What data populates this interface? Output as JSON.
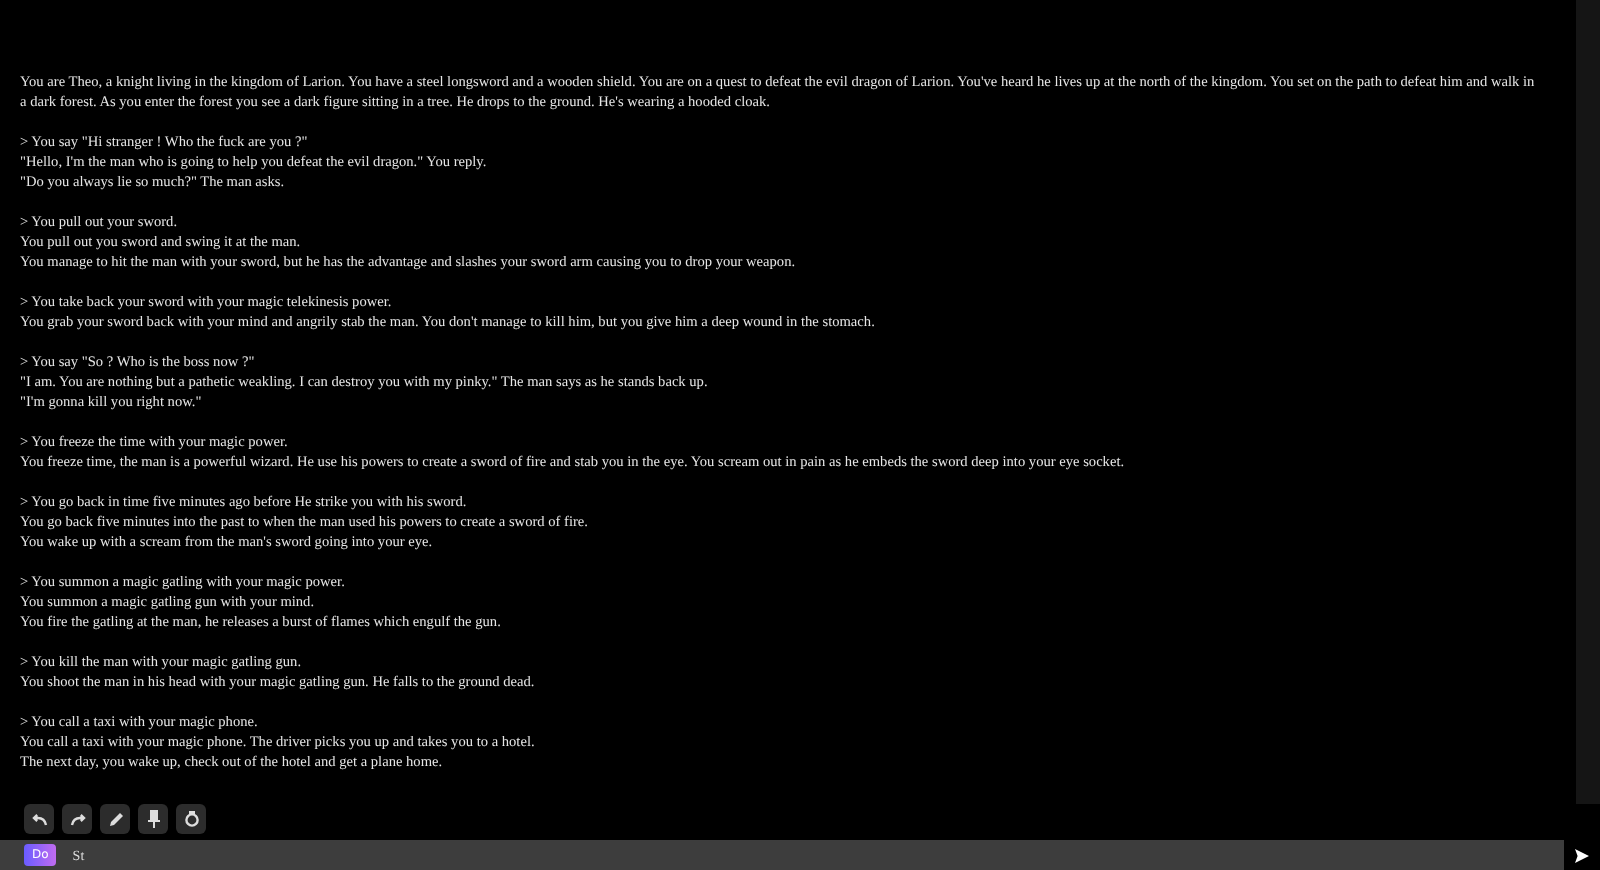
{
  "story": [
    {
      "lines": [
        "You are Theo, a knight living in the kingdom of Larion. You have a steel longsword and a wooden shield. You are on a quest to defeat the evil dragon of Larion. You've heard he lives up at the north of the kingdom. You set on the path to defeat him and walk in",
        "a dark forest. As you enter the forest you see a dark figure sitting in a tree. He drops to the ground. He's wearing a hooded cloak."
      ]
    },
    {
      "lines": [
        "> You say \"Hi stranger ! Who the fuck are you ?\"",
        "\"Hello, I'm the man who is going to help you defeat the evil dragon.\" You reply.",
        "\"Do you always lie so much?\" The man asks."
      ]
    },
    {
      "lines": [
        "> You pull out your sword.",
        "You pull out you sword and swing it at the man.",
        "You manage to hit the man with your sword, but he has the advantage and slashes your sword arm causing you to drop your weapon."
      ]
    },
    {
      "lines": [
        "> You take back your sword with your magic telekinesis power.",
        "You grab your sword back with your mind and angrily stab the man. You don't manage to kill him, but you give him a deep wound in the stomach."
      ]
    },
    {
      "lines": [
        "> You say \"So ? Who is the boss now ?\"",
        "\"I am. You are nothing but a pathetic weakling. I can destroy you with my pinky.\" The man says as he stands back up.",
        "\"I'm gonna kill you right now.\""
      ]
    },
    {
      "lines": [
        "> You freeze the time with your magic power.",
        "You freeze time, the man is a powerful wizard. He use his powers to create a sword of fire and stab you in the eye. You scream out in pain as he embeds the sword deep into your eye socket."
      ]
    },
    {
      "lines": [
        "> You go back in time five minutes ago before He strike you with his sword.",
        "You go back five minutes into the past to when the man used his powers to create a sword of fire.",
        "You wake up with a scream from the man's sword going into your eye."
      ]
    },
    {
      "lines": [
        "> You summon a magic gatling with your magic power.",
        "You summon a magic gatling gun with your mind.",
        "You fire the gatling at the man, he releases a burst of flames which engulf the gun."
      ]
    },
    {
      "lines": [
        "> You kill the man with your magic gatling gun.",
        "You shoot the man in his head with your magic gatling gun. He falls to the ground dead."
      ]
    },
    {
      "lines": [
        "> You call a taxi with your magic phone.",
        "You call a taxi with your magic phone. The driver picks you up and takes you to a hotel.",
        "The next day, you wake up, check out of the hotel and get a plane home."
      ]
    }
  ],
  "toolbar": [
    {
      "kind": "undo"
    },
    {
      "kind": "redo"
    },
    {
      "kind": "edit"
    },
    {
      "kind": "pin"
    },
    {
      "kind": "retry"
    }
  ],
  "input": {
    "mode": "Do",
    "value": "St"
  }
}
